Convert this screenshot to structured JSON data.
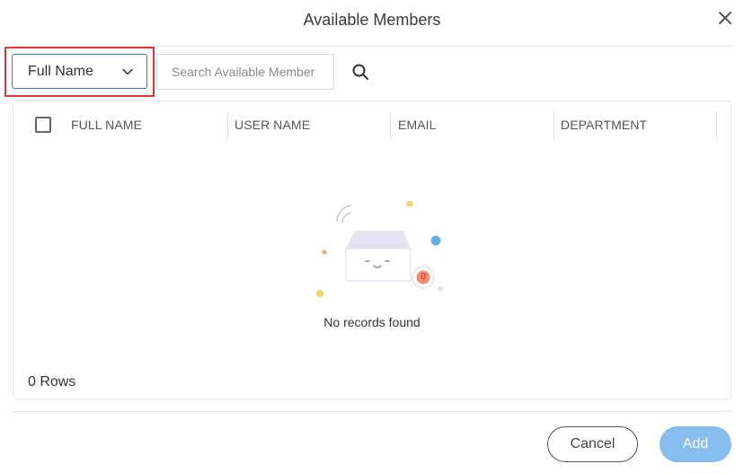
{
  "dialog": {
    "title": "Available Members",
    "close_icon": "close-icon"
  },
  "toolbar": {
    "filter_select": {
      "selected": "Full Name",
      "icon": "chevron-down-icon"
    },
    "search": {
      "placeholder": "Search Available Member",
      "value": "",
      "icon": "search-icon"
    }
  },
  "grid": {
    "columns": [
      "FULL NAME",
      "USER NAME",
      "EMAIL",
      "DEPARTMENT"
    ],
    "rows": [],
    "empty_state": {
      "message": "No records found",
      "badge": "0",
      "icon": "empty-box-icon"
    },
    "row_count_label": "0 Rows"
  },
  "footer": {
    "cancel_label": "Cancel",
    "add_label": "Add"
  },
  "colors": {
    "accent": "#3a7cc4",
    "highlight": "#e0353b",
    "add_button": "#86bdec"
  }
}
